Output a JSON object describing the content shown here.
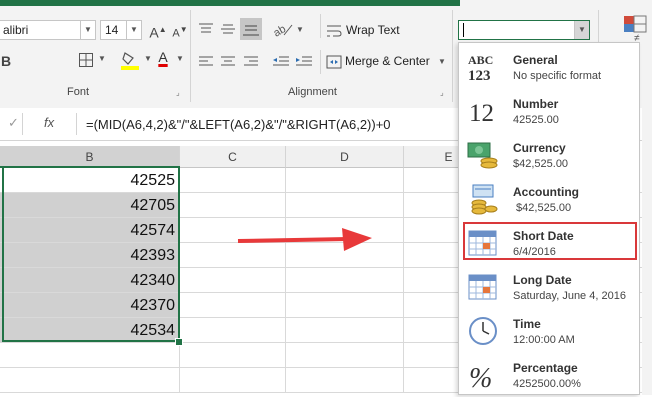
{
  "ribbon": {
    "font_name": "alibri",
    "font_size": "14",
    "wrap_text": "Wrap Text",
    "merge_center": "Merge & Center",
    "font_group_label": "Font",
    "alignment_group_label": "Alignment",
    "number_format_value": "",
    "bold": "B",
    "fill_color": "#ffff00",
    "font_color": "#e00000"
  },
  "formula_bar": {
    "cancel_icon": "check-icon",
    "fx": "fx",
    "formula": "=(MID(A6,4,2)&\"/\"&LEFT(A6,2)&\"/\"&RIGHT(A6,2))+0"
  },
  "sheet": {
    "columns": [
      "B",
      "C",
      "D",
      "E"
    ],
    "b_values": [
      "42525",
      "42705",
      "42574",
      "42393",
      "42340",
      "42370",
      "42534"
    ]
  },
  "number_formats": [
    {
      "title": "General",
      "sample": "No specific format",
      "icon": "general-abc-123-icon"
    },
    {
      "title": "Number",
      "sample": "42525.00",
      "icon": "number-12-icon"
    },
    {
      "title": "Currency",
      "sample": "$42,525.00",
      "icon": "currency-icon"
    },
    {
      "title": "Accounting",
      "sample": " $42,525.00",
      "icon": "accounting-icon"
    },
    {
      "title": "Short Date",
      "sample": "6/4/2016",
      "icon": "calendar-icon"
    },
    {
      "title": "Long Date",
      "sample": "Saturday, June 4, 2016",
      "icon": "calendar-icon"
    },
    {
      "title": "Time",
      "sample": "12:00:00 AM",
      "icon": "clock-icon"
    },
    {
      "title": "Percentage",
      "sample": "4252500.00%",
      "icon": "percent-icon"
    }
  ],
  "highlight_color": "#d9383a",
  "arrow_color": "#e8393a"
}
